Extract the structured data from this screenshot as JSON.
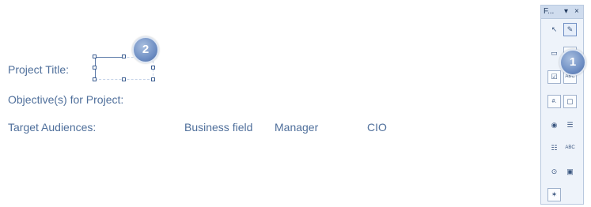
{
  "form": {
    "project_title_label": "Project Title:",
    "objectives_label": "Objective(s) for Project:",
    "audiences_label": "Target Audiences:",
    "audiences": [
      "Business field",
      "Manager",
      "CIO"
    ]
  },
  "callouts": {
    "one": "1",
    "two": "2"
  },
  "toolbox": {
    "title": "F...",
    "menu_glyph": "▾",
    "close_glyph": "×",
    "tools": [
      {
        "name": "select-pointer-icon",
        "glyph": "↖"
      },
      {
        "name": "design-mode-icon",
        "glyph": "✎"
      },
      {
        "name": "form-field-icon",
        "glyph": "▭"
      },
      {
        "name": "text-field-icon",
        "glyph": "abl"
      },
      {
        "name": "checkbox-icon",
        "glyph": "☑"
      },
      {
        "name": "label-icon",
        "glyph": "ABC"
      },
      {
        "name": "numeric-field-icon",
        "glyph": "#."
      },
      {
        "name": "button-icon",
        "glyph": "▢"
      },
      {
        "name": "option-button-icon",
        "glyph": "◉"
      },
      {
        "name": "list-box-icon",
        "glyph": "☰"
      },
      {
        "name": "combo-box-icon",
        "glyph": "☷"
      },
      {
        "name": "text-label-icon",
        "glyph": "ABC"
      },
      {
        "name": "group-box-icon",
        "glyph": "⊙"
      },
      {
        "name": "image-control-icon",
        "glyph": "▣"
      },
      {
        "name": "wizard-icon",
        "glyph": "✶"
      }
    ]
  }
}
